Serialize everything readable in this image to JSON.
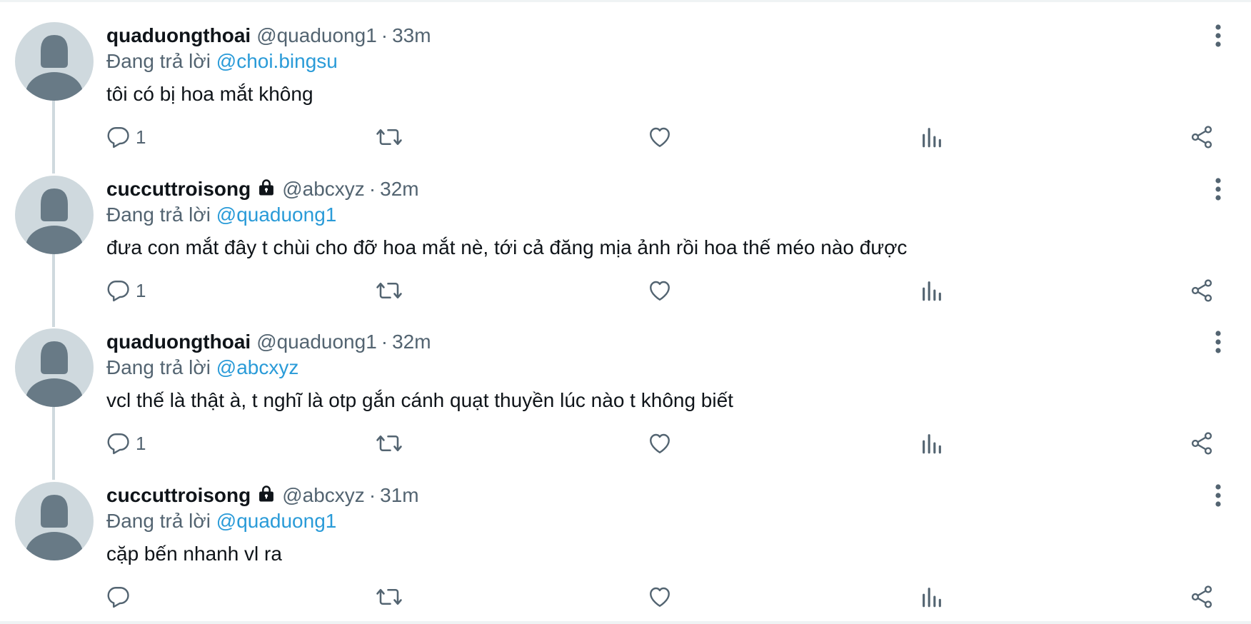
{
  "colors": {
    "text_primary": "#0f1419",
    "text_secondary": "#536471",
    "mention": "#2a9bd8",
    "avatar_bg": "#cfd9de",
    "avatar_fg": "#687a86",
    "thread_line": "#cfd9de"
  },
  "tweets": [
    {
      "display_name": "quaduongthoai",
      "locked": false,
      "handle": "@quaduong1",
      "separator": "·",
      "time": "33m",
      "reply_prefix": "Đang trả lời",
      "reply_to": "@choi.bingsu",
      "text": "tôi có bị hoa mắt không",
      "reply_count": "1",
      "icons": {
        "avatar": "default-avatar-icon",
        "more": "more-vertical-icon",
        "reply": "reply-bubble-icon",
        "retweet": "retweet-icon",
        "like": "heart-icon",
        "views": "bar-chart-icon",
        "share": "share-icon"
      }
    },
    {
      "display_name": "cuccuttroisong",
      "locked": true,
      "handle": "@abcxyz",
      "separator": "·",
      "time": "32m",
      "reply_prefix": "Đang trả lời",
      "reply_to": "@quaduong1",
      "text": "đưa con mắt đây t chùi cho đỡ hoa mắt nè, tới cả đăng mịa ảnh rồi hoa thế méo nào được",
      "reply_count": "1"
    },
    {
      "display_name": "quaduongthoai",
      "locked": false,
      "handle": "@quaduong1",
      "separator": "·",
      "time": "32m",
      "reply_prefix": "Đang trả lời",
      "reply_to": "@abcxyz",
      "text": "vcl thế là thật à, t nghĩ là otp gắn cánh quạt thuyền lúc nào t không biết",
      "reply_count": "1"
    },
    {
      "display_name": "cuccuttroisong",
      "locked": true,
      "handle": "@abcxyz",
      "separator": "·",
      "time": "31m",
      "reply_prefix": "Đang trả lời",
      "reply_to": "@quaduong1",
      "text": "cặp bến nhanh vl ra",
      "reply_count": ""
    }
  ]
}
